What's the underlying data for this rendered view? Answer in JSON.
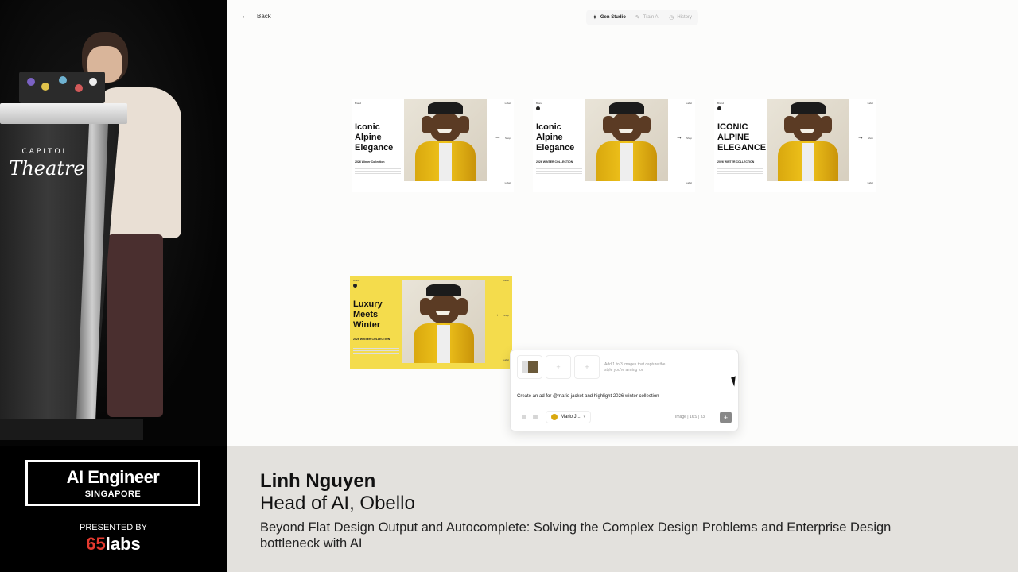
{
  "stage": {
    "venue_line1": "CAPITOL",
    "venue_line2": "Theatre"
  },
  "app": {
    "back_label": "Back",
    "tabs": [
      {
        "label": "Gen Studio",
        "icon": "sparkle-icon",
        "active": true
      },
      {
        "label": "Train AI",
        "icon": "wand-icon",
        "active": false
      },
      {
        "label": "History",
        "icon": "clock-icon",
        "active": false
      }
    ],
    "cards": [
      {
        "brand": "Brand",
        "brand_r": "Label",
        "headline": "Iconic Alpine Elegance",
        "sub": "2026 Winter Collection",
        "tag": "Shop",
        "foot": "Label"
      },
      {
        "brand": "Brand",
        "brand_r": "Label",
        "headline": "Iconic Alpine Elegance",
        "sub": "2026 WINTER COLLECTION",
        "tag": "Shop",
        "foot": "Label"
      },
      {
        "brand": "Brand",
        "brand_r": "Label",
        "headline": "ICONIC ALPINE ELEGANCE",
        "sub": "2026 WINTER COLLECTION",
        "tag": "Shop",
        "foot": "Label"
      },
      {
        "brand": "Brand",
        "brand_r": "Label",
        "headline": "Luxury Meets Winter",
        "sub": "2026 WINTER COLLECTION",
        "tag": "Shop",
        "foot": "Label"
      }
    ],
    "prompt": {
      "ref_help": "Add 1 to 3 images that capture the style you're aiming for",
      "text": "Create an ad for @mario jacket and highlight 2026 winter collection",
      "model": "Mario J...",
      "meta": "Image | 16:9 | x3",
      "send_icon": "+"
    }
  },
  "banner": {
    "event_title": "AI Engineer",
    "event_sub": "SINGAPORE",
    "presented_by": "PRESENTED BY",
    "sponsor_num": "65",
    "sponsor_word": "labs",
    "speaker_name": "Linh Nguyen",
    "speaker_role": "Head of AI, Obello",
    "talk_title": "Beyond Flat Design Output and Autocomplete: Solving the Complex Design Problems and Enterprise Design bottleneck with AI"
  },
  "colors": {
    "accent_yellow": "#f4dc4c",
    "sponsor_red": "#e43a2f",
    "caption_bg": "#e3e1dd"
  }
}
